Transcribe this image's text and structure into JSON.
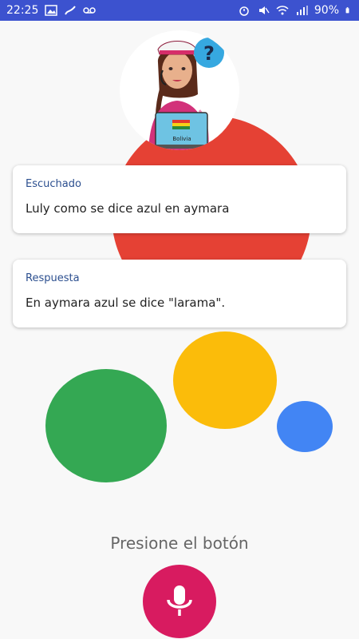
{
  "status_bar": {
    "time": "22:25",
    "battery": "90%"
  },
  "cards": [
    {
      "label": "Escuchado",
      "text": "Luly como se dice azul en aymara"
    },
    {
      "label": "Respuesta",
      "text": "En aymara azul se dice \"larama\"."
    }
  ],
  "avatar": {
    "laptop_label": "Bolivia"
  },
  "prompt": "Presione el botón",
  "colors": {
    "status_bar": "#3c52cf",
    "red": "#e54134",
    "yellow": "#fbbc0a",
    "green": "#34a853",
    "blue": "#4285f4",
    "mic_button": "#d81b60",
    "label_text": "#2c4f8f"
  },
  "icons": [
    "image-icon",
    "signal-icon",
    "voicemail-icon",
    "alarm-icon",
    "mute-icon",
    "wifi-icon",
    "cellular-icon",
    "battery-icon",
    "microphone-icon",
    "question-mark-icon"
  ]
}
